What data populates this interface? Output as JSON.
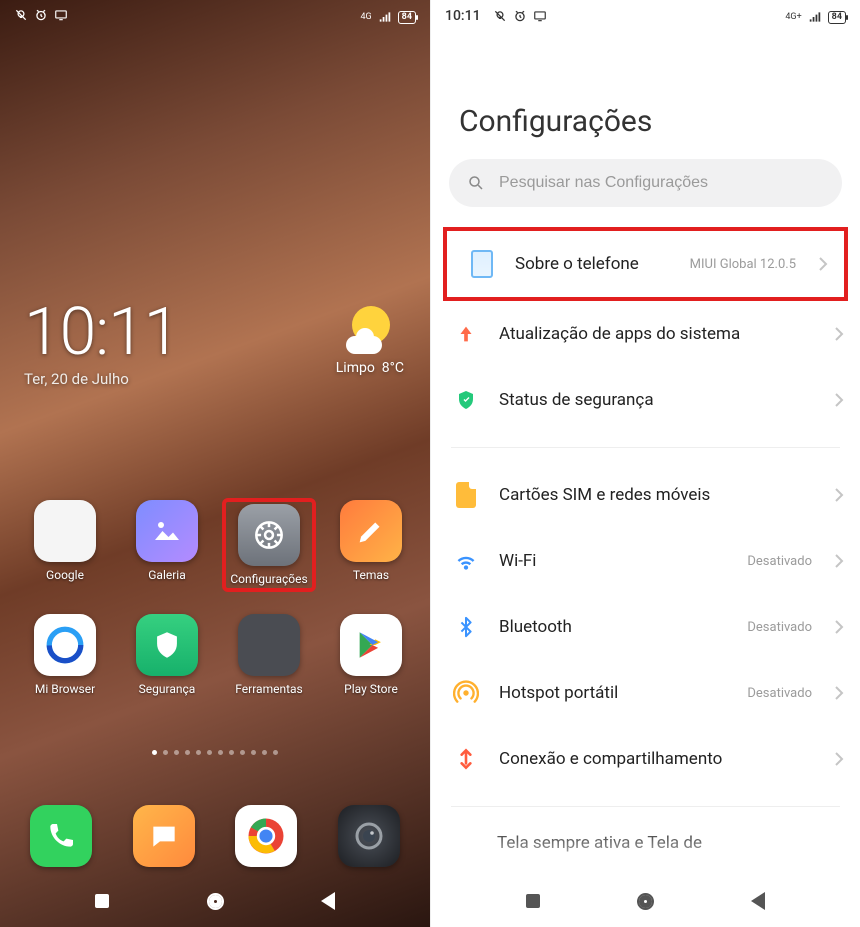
{
  "left": {
    "status": {
      "battery": "84",
      "net": "4G"
    },
    "clock": {
      "time": "10:11",
      "date": "Ter, 20 de Julho"
    },
    "weather": {
      "cond": "Limpo",
      "temp": "8°C"
    },
    "apps_row1": [
      {
        "label": "Google",
        "icon": "google-folder"
      },
      {
        "label": "Galeria",
        "icon": "gallery"
      },
      {
        "label": "Configurações",
        "icon": "settings",
        "highlight": true
      },
      {
        "label": "Temas",
        "icon": "themes"
      }
    ],
    "apps_row2": [
      {
        "label": "Mi Browser",
        "icon": "mibrowser"
      },
      {
        "label": "Segurança",
        "icon": "security"
      },
      {
        "label": "Ferramentas",
        "icon": "tools-folder"
      },
      {
        "label": "Play Store",
        "icon": "playstore"
      }
    ],
    "dock": [
      {
        "icon": "phone"
      },
      {
        "icon": "messages"
      },
      {
        "icon": "chrome"
      },
      {
        "icon": "camera"
      }
    ],
    "page_dot_count": 12,
    "page_dot_active": 0
  },
  "right": {
    "status": {
      "time": "10:11",
      "battery": "84",
      "net": "4G+"
    },
    "title": "Configurações",
    "search_placeholder": "Pesquisar nas Configurações",
    "items": [
      {
        "icon": "about",
        "label": "Sobre o telefone",
        "trail": "MIUI Global 12.0.5",
        "highlight": true
      },
      {
        "icon": "update",
        "label": "Atualização de apps do sistema"
      },
      {
        "icon": "shield",
        "label": "Status de segurança"
      },
      {
        "divider": true
      },
      {
        "icon": "sim",
        "label": "Cartões SIM e redes móveis"
      },
      {
        "icon": "wifi",
        "label": "Wi-Fi",
        "trail": "Desativado"
      },
      {
        "icon": "bt",
        "label": "Bluetooth",
        "trail": "Desativado"
      },
      {
        "icon": "hotspot",
        "label": "Hotspot portátil",
        "trail": "Desativado"
      },
      {
        "icon": "share",
        "label": "Conexão e compartilhamento"
      },
      {
        "divider": true
      }
    ],
    "truncated_item_label": "Tela sempre ativa e Tela de"
  }
}
